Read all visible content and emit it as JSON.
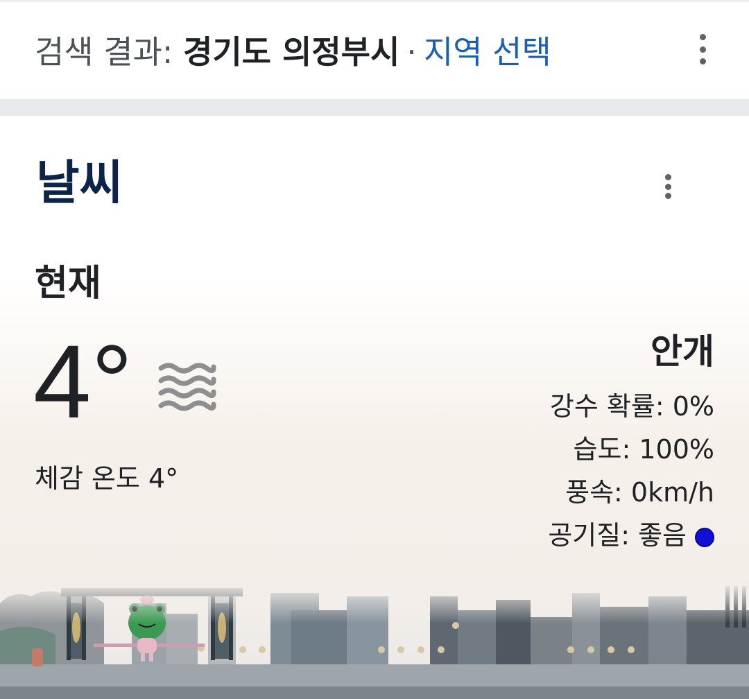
{
  "search_bar": {
    "prefix": "검색 결과:",
    "place": "경기도 의정부시",
    "separator": "·",
    "region_link": "지역 선택"
  },
  "weather": {
    "title": "날씨",
    "now_label": "현재",
    "temperature": "4°",
    "condition_icon": "fog-icon",
    "feels_like": "체감 온도 4°",
    "condition": "안개",
    "details": [
      {
        "key": "precip",
        "text": "강수 확률: 0%"
      },
      {
        "key": "humidity",
        "text": "습도: 100%"
      },
      {
        "key": "wind",
        "text": "풍속: 0km/h"
      },
      {
        "key": "air",
        "text": "공기질: 좋음"
      }
    ],
    "air_quality_color": "#1010d8"
  },
  "colors": {
    "link": "#1a5fb4",
    "title": "#0b2447",
    "text": "#202124",
    "frog": "#3a9a52"
  }
}
